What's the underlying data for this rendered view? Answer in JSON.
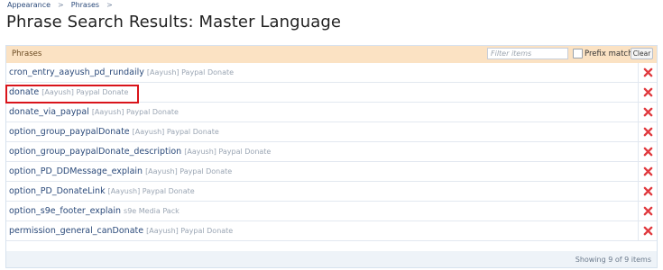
{
  "breadcrumb": [
    {
      "label": "Appearance",
      "sep": ">"
    },
    {
      "label": "Phrases",
      "sep": ">"
    }
  ],
  "page_title": "Phrase Search Results: Master Language",
  "panel": {
    "header_label": "Phrases",
    "filter_placeholder": "Filter items",
    "prefix_label": "Prefix match",
    "clear_label": "Clear"
  },
  "rows": [
    {
      "name": "cron_entry_aayush_pd_rundaily",
      "addon": "[Aayush] Paypal Donate"
    },
    {
      "name": "donate",
      "addon": "[Aayush] Paypal Donate"
    },
    {
      "name": "donate_via_paypal",
      "addon": "[Aayush] Paypal Donate"
    },
    {
      "name": "option_group_paypalDonate",
      "addon": "[Aayush] Paypal Donate"
    },
    {
      "name": "option_group_paypalDonate_description",
      "addon": "[Aayush] Paypal Donate"
    },
    {
      "name": "option_PD_DDMessage_explain",
      "addon": "[Aayush] Paypal Donate"
    },
    {
      "name": "option_PD_DonateLink",
      "addon": "[Aayush] Paypal Donate"
    },
    {
      "name": "option_s9e_footer_explain",
      "addon": "s9e Media Pack"
    },
    {
      "name": "permission_general_canDonate",
      "addon": "[Aayush] Paypal Donate"
    }
  ],
  "footer": {
    "count_text": "Showing 9 of 9 items"
  },
  "colors": {
    "delete_icon": "#e0393e",
    "highlight_box": "#d9141b",
    "header_bg": "#fbe2c3"
  },
  "icons": {
    "delete": "delete-x-icon"
  }
}
